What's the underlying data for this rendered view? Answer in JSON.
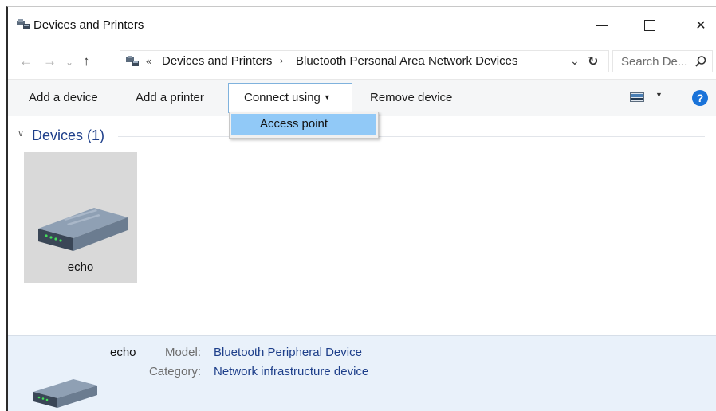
{
  "window": {
    "title": "Devices and Printers"
  },
  "address": {
    "overflow": "«",
    "crumbs": [
      "Devices and Printers",
      "Bluetooth Personal Area Network Devices"
    ],
    "separator": "›"
  },
  "search": {
    "placeholder": "Search De..."
  },
  "toolbar": {
    "add_device": "Add a device",
    "add_printer": "Add a printer",
    "connect_using": "Connect using",
    "remove_device": "Remove device",
    "help": "?"
  },
  "dropdown": {
    "items": [
      "Access point"
    ]
  },
  "group": {
    "title": "Devices (1)"
  },
  "devices": [
    {
      "name": "echo"
    }
  ],
  "details": {
    "name": "echo",
    "model_label": "Model:",
    "model_value": "Bluetooth Peripheral Device",
    "category_label": "Category:",
    "category_value": "Network infrastructure device"
  },
  "colors": {
    "accent": "#1a73d9",
    "selection": "#91c9f7",
    "link_text": "#1e3f8a",
    "details_bg": "#e9f1fa"
  }
}
